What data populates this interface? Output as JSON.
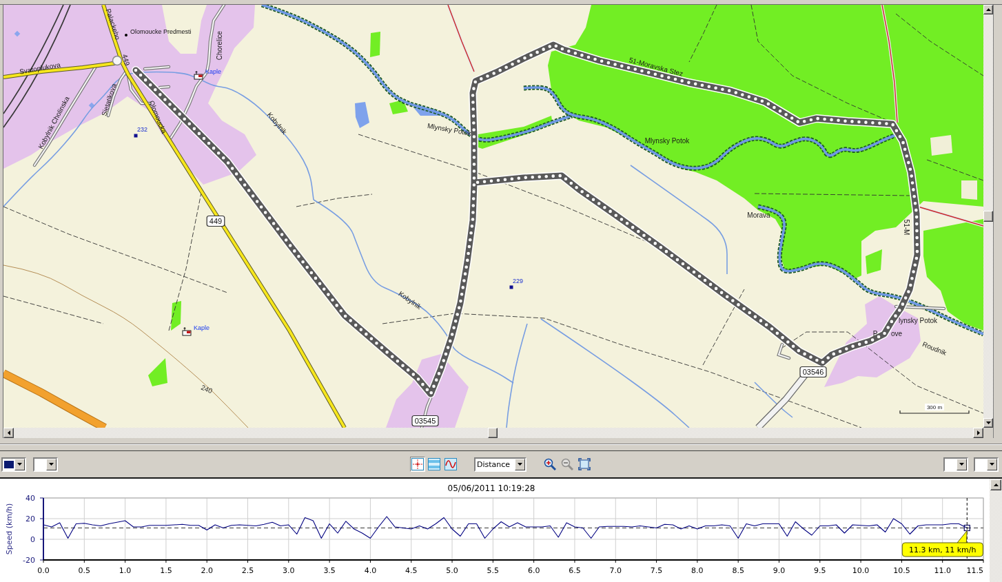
{
  "map": {
    "labels": [
      {
        "text": "Palackeho",
        "kind": "line_label"
      },
      {
        "text": "Olomoucke Predmesti",
        "kind": "place"
      },
      {
        "text": "Chorelice",
        "kind": "line_label"
      },
      {
        "text": "449",
        "kind": "line_label"
      },
      {
        "text": "51-Moravska Stez",
        "kind": "line_label"
      },
      {
        "text": "Svatoplukova",
        "kind": "line_label"
      },
      {
        "text": "Kaple",
        "kind": "poi"
      },
      {
        "text": "Sietatikova",
        "kind": "line_label"
      },
      {
        "text": "Olomoucka",
        "kind": "line_label"
      },
      {
        "text": "Kobylnik Cholinska",
        "kind": "line_label"
      },
      {
        "text": "Kobylnik",
        "kind": "line_label"
      },
      {
        "text": "Mlynsky Potok",
        "kind": "line_label"
      },
      {
        "text": "232",
        "kind": "spot_height"
      },
      {
        "text": "Mlynsky Potok",
        "kind": "line_label"
      },
      {
        "text": "Morava",
        "kind": "line_label"
      },
      {
        "text": "449",
        "kind": "shield"
      },
      {
        "text": "51-M",
        "kind": "line_label"
      },
      {
        "text": "229",
        "kind": "spot_height"
      },
      {
        "text": "Kobylnik",
        "kind": "line_label"
      },
      {
        "text": "lynsky Potok",
        "kind": "line_label"
      },
      {
        "text": "Kaple",
        "kind": "poi"
      },
      {
        "text": "P",
        "kind": "line_label"
      },
      {
        "text": "ove",
        "kind": "line_label"
      },
      {
        "text": "Roudnik",
        "kind": "line_label"
      },
      {
        "text": "03546",
        "kind": "shield"
      },
      {
        "text": "240",
        "kind": "contour"
      },
      {
        "text": "300 m",
        "kind": "scale"
      },
      {
        "text": "03545",
        "kind": "shield"
      }
    ]
  },
  "toolbar": {
    "left_pickers": [
      {
        "kind": "color",
        "color": "#0a1a70"
      },
      {
        "kind": "blank"
      }
    ],
    "view_buttons": [
      {
        "kind": "crosshair",
        "selected": true
      },
      {
        "kind": "bands",
        "selected": false
      },
      {
        "kind": "curve",
        "selected": false
      }
    ],
    "axis_select": {
      "value": "Distance"
    },
    "zoom_buttons": [
      {
        "kind": "zoom_in",
        "disabled": false
      },
      {
        "kind": "zoom_out",
        "disabled": true
      },
      {
        "kind": "fit",
        "disabled": false
      }
    ],
    "right_pickers": [
      {
        "kind": "blank"
      },
      {
        "kind": "blank"
      }
    ]
  },
  "profile_chart": {
    "chart_data": {
      "type": "line",
      "title": "05/06/2011 10:19:28",
      "ylabel": "Speed (km/h)",
      "x": [
        0,
        0.1,
        0.2,
        0.3,
        0.4,
        0.5,
        0.6,
        0.7,
        0.8,
        0.9,
        1,
        1.1,
        1.2,
        1.3,
        1.4,
        1.5,
        1.6,
        1.7,
        1.8,
        1.9,
        2,
        2.1,
        2.2,
        2.3,
        2.4,
        2.5,
        2.6,
        2.7,
        2.8,
        2.9,
        3,
        3.1,
        3.2,
        3.3,
        3.4,
        3.5,
        3.6,
        3.7,
        3.8,
        3.9,
        4,
        4.1,
        4.2,
        4.3,
        4.4,
        4.5,
        4.6,
        4.7,
        4.8,
        4.9,
        5,
        5.1,
        5.2,
        5.3,
        5.4,
        5.5,
        5.6,
        5.7,
        5.8,
        5.9,
        6,
        6.1,
        6.2,
        6.3,
        6.4,
        6.5,
        6.6,
        6.7,
        6.8,
        6.9,
        7,
        7.1,
        7.2,
        7.3,
        7.4,
        7.5,
        7.6,
        7.7,
        7.8,
        7.9,
        8,
        8.1,
        8.2,
        8.3,
        8.4,
        8.5,
        8.6,
        8.7,
        8.8,
        8.9,
        9,
        9.1,
        9.2,
        9.3,
        9.4,
        9.5,
        9.6,
        9.7,
        9.8,
        9.9,
        10,
        10.1,
        10.2,
        10.3,
        10.4,
        10.5,
        10.6,
        10.7,
        10.8,
        10.9,
        11,
        11.1,
        11.2,
        11.3
      ],
      "series": [
        {
          "color": "#000080",
          "values": [
            14,
            12,
            16,
            1,
            15,
            15.5,
            14,
            13,
            15,
            16.5,
            18,
            12,
            12,
            13.5,
            13.5,
            13.5,
            14,
            14.5,
            13.5,
            13.5,
            9,
            14,
            11,
            13.5,
            14,
            13.5,
            13,
            14.5,
            16.5,
            13,
            14,
            5,
            21,
            18,
            1,
            15,
            6,
            17.5,
            10,
            6,
            1,
            12,
            22,
            12,
            11,
            10,
            13,
            10,
            15,
            21,
            10,
            3,
            15,
            15,
            1,
            10,
            17,
            12,
            16,
            12,
            12,
            12,
            13,
            2,
            16,
            12,
            11,
            1,
            12,
            12.5,
            12.5,
            12.5,
            12,
            13,
            12,
            11,
            14.5,
            14,
            10,
            13,
            10,
            13,
            13,
            14,
            13,
            1,
            15,
            13,
            15,
            15,
            15,
            3,
            17,
            10,
            4,
            13,
            13,
            14,
            6,
            14,
            13.5,
            13,
            14,
            7,
            20,
            15,
            5,
            13,
            14,
            14,
            14,
            15,
            15,
            11
          ]
        }
      ],
      "xlim": [
        0,
        11.5
      ],
      "ylim": [
        -20,
        40
      ],
      "xticks": [
        {
          "value": 0,
          "label": "0.0"
        },
        {
          "value": 0.5,
          "label": "0.5"
        },
        {
          "value": 1,
          "label": "1.0"
        },
        {
          "value": 1.5,
          "label": "1.5"
        },
        {
          "value": 2,
          "label": "2.0"
        },
        {
          "value": 2.5,
          "label": "2.5"
        },
        {
          "value": 3,
          "label": "3.0"
        },
        {
          "value": 3.5,
          "label": "3.5"
        },
        {
          "value": 4,
          "label": "4.0"
        },
        {
          "value": 4.5,
          "label": "4.5"
        },
        {
          "value": 5,
          "label": "5.0"
        },
        {
          "value": 5.5,
          "label": "5.5"
        },
        {
          "value": 6,
          "label": "6.0"
        },
        {
          "value": 6.5,
          "label": "6.5"
        },
        {
          "value": 7,
          "label": "7.0"
        },
        {
          "value": 7.5,
          "label": "7.5"
        },
        {
          "value": 8,
          "label": "8.0"
        },
        {
          "value": 8.5,
          "label": "8.5"
        },
        {
          "value": 9,
          "label": "9.0"
        },
        {
          "value": 9.5,
          "label": "9.5"
        },
        {
          "value": 10,
          "label": "10.0"
        },
        {
          "value": 10.5,
          "label": "10.5"
        },
        {
          "value": 11,
          "label": "11.0"
        },
        {
          "value": 11.5,
          "label": "11.5"
        }
      ],
      "yticks": [
        -20,
        0,
        20,
        40
      ],
      "grid": true,
      "ref_lines": [
        {
          "axis": "y",
          "value": 11
        },
        {
          "axis": "x",
          "value": 11.3
        }
      ],
      "annotations": [
        {
          "x": 11.3,
          "y": 11,
          "text": "11.3 km, 11 km/h"
        }
      ]
    }
  }
}
